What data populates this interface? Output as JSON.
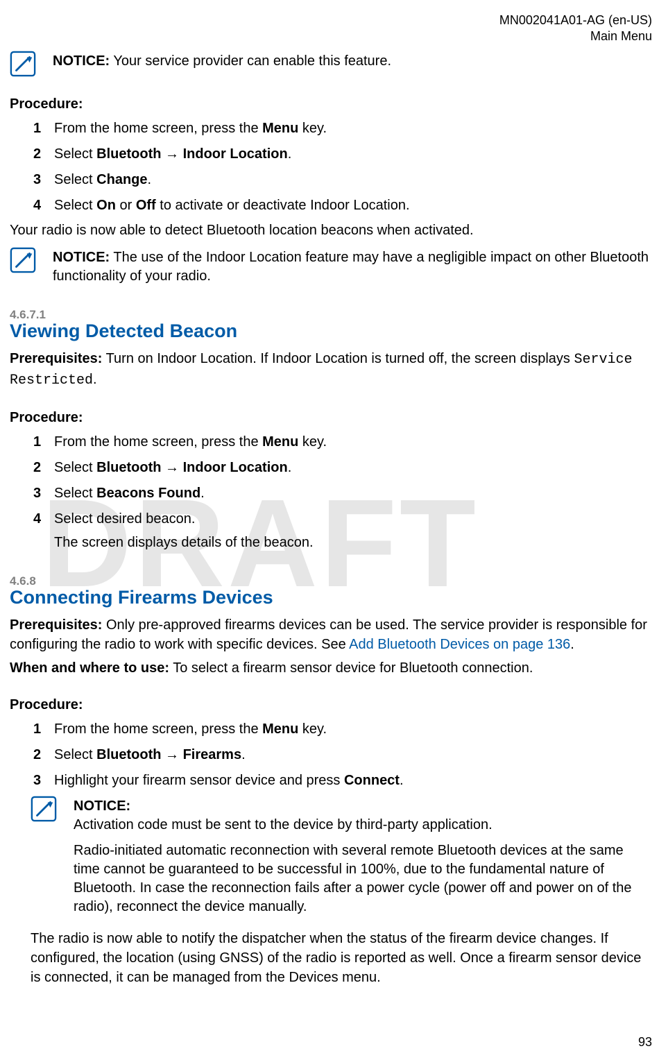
{
  "header": {
    "doc_id": "MN002041A01-AG (en-US)",
    "section": "Main Menu"
  },
  "watermark": "DRAFT",
  "page_number": "93",
  "notice1": {
    "label": "NOTICE:",
    "text": " Your service provider can enable this feature."
  },
  "proc1": {
    "label": "Procedure:",
    "steps": [
      {
        "n": "1",
        "pre": "From the home screen, press the ",
        "b1": "Menu",
        "post": " key."
      },
      {
        "n": "2",
        "pre": "Select ",
        "b1": "Bluetooth",
        "mid": " → ",
        "b2": "Indoor Location",
        "post": "."
      },
      {
        "n": "3",
        "pre": "Select ",
        "b1": "Change",
        "post": "."
      },
      {
        "n": "4",
        "pre": "Select ",
        "b1": "On",
        "mid": " or ",
        "b2": "Off",
        "post": " to activate or deactivate Indoor Location."
      }
    ],
    "result": "Your radio is now able to detect Bluetooth location beacons when activated."
  },
  "notice2": {
    "label": "NOTICE:",
    "text": " The use of the Indoor Location feature may have a negligible impact on other Bluetooth functionality of your radio."
  },
  "sec1": {
    "num": "4.6.7.1",
    "title": "Viewing Detected Beacon",
    "prereq_label": "Prerequisites:",
    "prereq_text1": " Turn on Indoor Location. If Indoor Location is turned off, the screen displays ",
    "prereq_mono": "Service Restricted",
    "prereq_text2": ".",
    "proc_label": "Procedure:",
    "steps": [
      {
        "n": "1",
        "pre": "From the home screen, press the ",
        "b1": "Menu",
        "post": " key."
      },
      {
        "n": "2",
        "pre": "Select ",
        "b1": "Bluetooth",
        "mid": " → ",
        "b2": "Indoor Location",
        "post": "."
      },
      {
        "n": "3",
        "pre": "Select ",
        "b1": "Beacons Found",
        "post": "."
      },
      {
        "n": "4",
        "pre": "Select desired beacon.",
        "sub": "The screen displays details of the beacon."
      }
    ]
  },
  "sec2": {
    "num": "4.6.8",
    "title": "Connecting Firearms Devices",
    "prereq_label": "Prerequisites:",
    "prereq_text1": " Only pre-approved firearms devices can be used. The service provider is responsible for configuring the radio to work with specific devices. See ",
    "prereq_link": "Add Bluetooth Devices on page 136",
    "prereq_text2": ".",
    "when_label": "When and where to use:",
    "when_text": " To select a firearm sensor device for Bluetooth connection.",
    "proc_label": "Procedure:",
    "steps": [
      {
        "n": "1",
        "pre": "From the home screen, press the ",
        "b1": "Menu",
        "post": " key."
      },
      {
        "n": "2",
        "pre": "Select ",
        "b1": "Bluetooth",
        "mid": " → ",
        "b2": "Firearms",
        "post": "."
      },
      {
        "n": "3",
        "pre": "Highlight your firearm sensor device and press ",
        "b1": "Connect",
        "post": "."
      }
    ],
    "notice": {
      "label": "NOTICE:",
      "line1": "Activation code must be sent to the device by third-party application.",
      "line2": "Radio-initiated automatic reconnection with several remote Bluetooth devices at the same time cannot be guaranteed to be successful in 100%, due to the fundamental nature of Bluetooth. In case the reconnection fails after a power cycle (power off and power on of the radio), reconnect the device manually."
    },
    "result": "The radio is now able to notify the dispatcher when the status of the firearm device changes. If configured, the location (using GNSS) of the radio is reported as well. Once a firearm sensor device is connected, it can be managed from the Devices menu."
  }
}
